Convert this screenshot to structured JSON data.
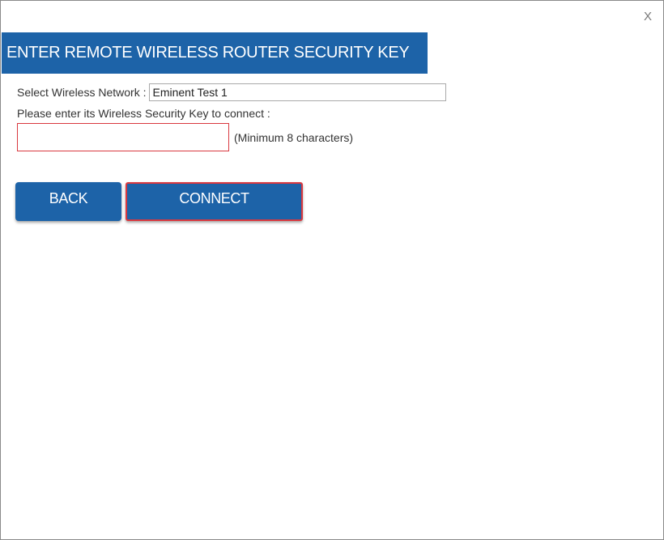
{
  "dialog": {
    "close_label": "X",
    "title": "ENTER REMOTE WIRELESS ROUTER SECURITY KEY"
  },
  "form": {
    "network_label": "Select Wireless Network :",
    "network_value": "Eminent Test 1",
    "key_prompt": "Please enter its Wireless Security Key to connect :",
    "key_value": "",
    "key_hint": "(Minimum 8 characters)"
  },
  "buttons": {
    "back_label": "BACK",
    "connect_label": "CONNECT"
  },
  "colors": {
    "accent": "#1d63a8",
    "error_border": "#d9383f"
  }
}
